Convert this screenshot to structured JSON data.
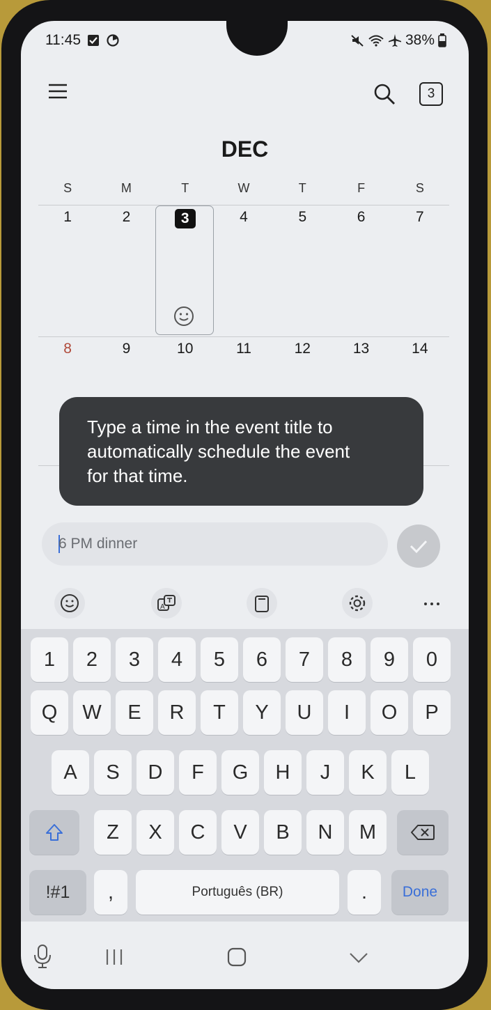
{
  "status": {
    "time": "11:45",
    "battery": "38%"
  },
  "header": {
    "today_number": "3",
    "month": "DEC"
  },
  "calendar": {
    "weekdays": [
      "S",
      "M",
      "T",
      "W",
      "T",
      "F",
      "S"
    ],
    "weeks": [
      [
        "1",
        "2",
        "3",
        "4",
        "5",
        "6",
        "7"
      ],
      [
        "8",
        "9",
        "10",
        "11",
        "12",
        "13",
        "14"
      ]
    ]
  },
  "tooltip": {
    "line1": "Type a time in the event title to",
    "line2": "automatically schedule the event",
    "line3": "for that time."
  },
  "event_input": {
    "placeholder": "6 PM dinner"
  },
  "keyboard": {
    "numbers": [
      "1",
      "2",
      "3",
      "4",
      "5",
      "6",
      "7",
      "8",
      "9",
      "0"
    ],
    "row1": [
      "Q",
      "W",
      "E",
      "R",
      "T",
      "Y",
      "U",
      "I",
      "O",
      "P"
    ],
    "row2": [
      "A",
      "S",
      "D",
      "F",
      "G",
      "H",
      "J",
      "K",
      "L"
    ],
    "row3": [
      "Z",
      "X",
      "C",
      "V",
      "B",
      "N",
      "M"
    ],
    "symbols": "!#1",
    "comma": ",",
    "space": "Português (BR)",
    "period": ".",
    "done": "Done"
  },
  "colors": {
    "accent": "#3a6fd8",
    "sunday": "#b04a3a",
    "tooltip_bg": "#383a3d"
  },
  "icons": [
    "menu-icon",
    "search-icon",
    "smiley-icon",
    "checkmark-icon",
    "emoji-icon",
    "translate-icon",
    "clipboard-icon",
    "settings-icon",
    "more-icon",
    "shift-icon",
    "backspace-icon",
    "mic-icon",
    "recents-icon",
    "home-icon",
    "hide-keyboard-icon"
  ]
}
